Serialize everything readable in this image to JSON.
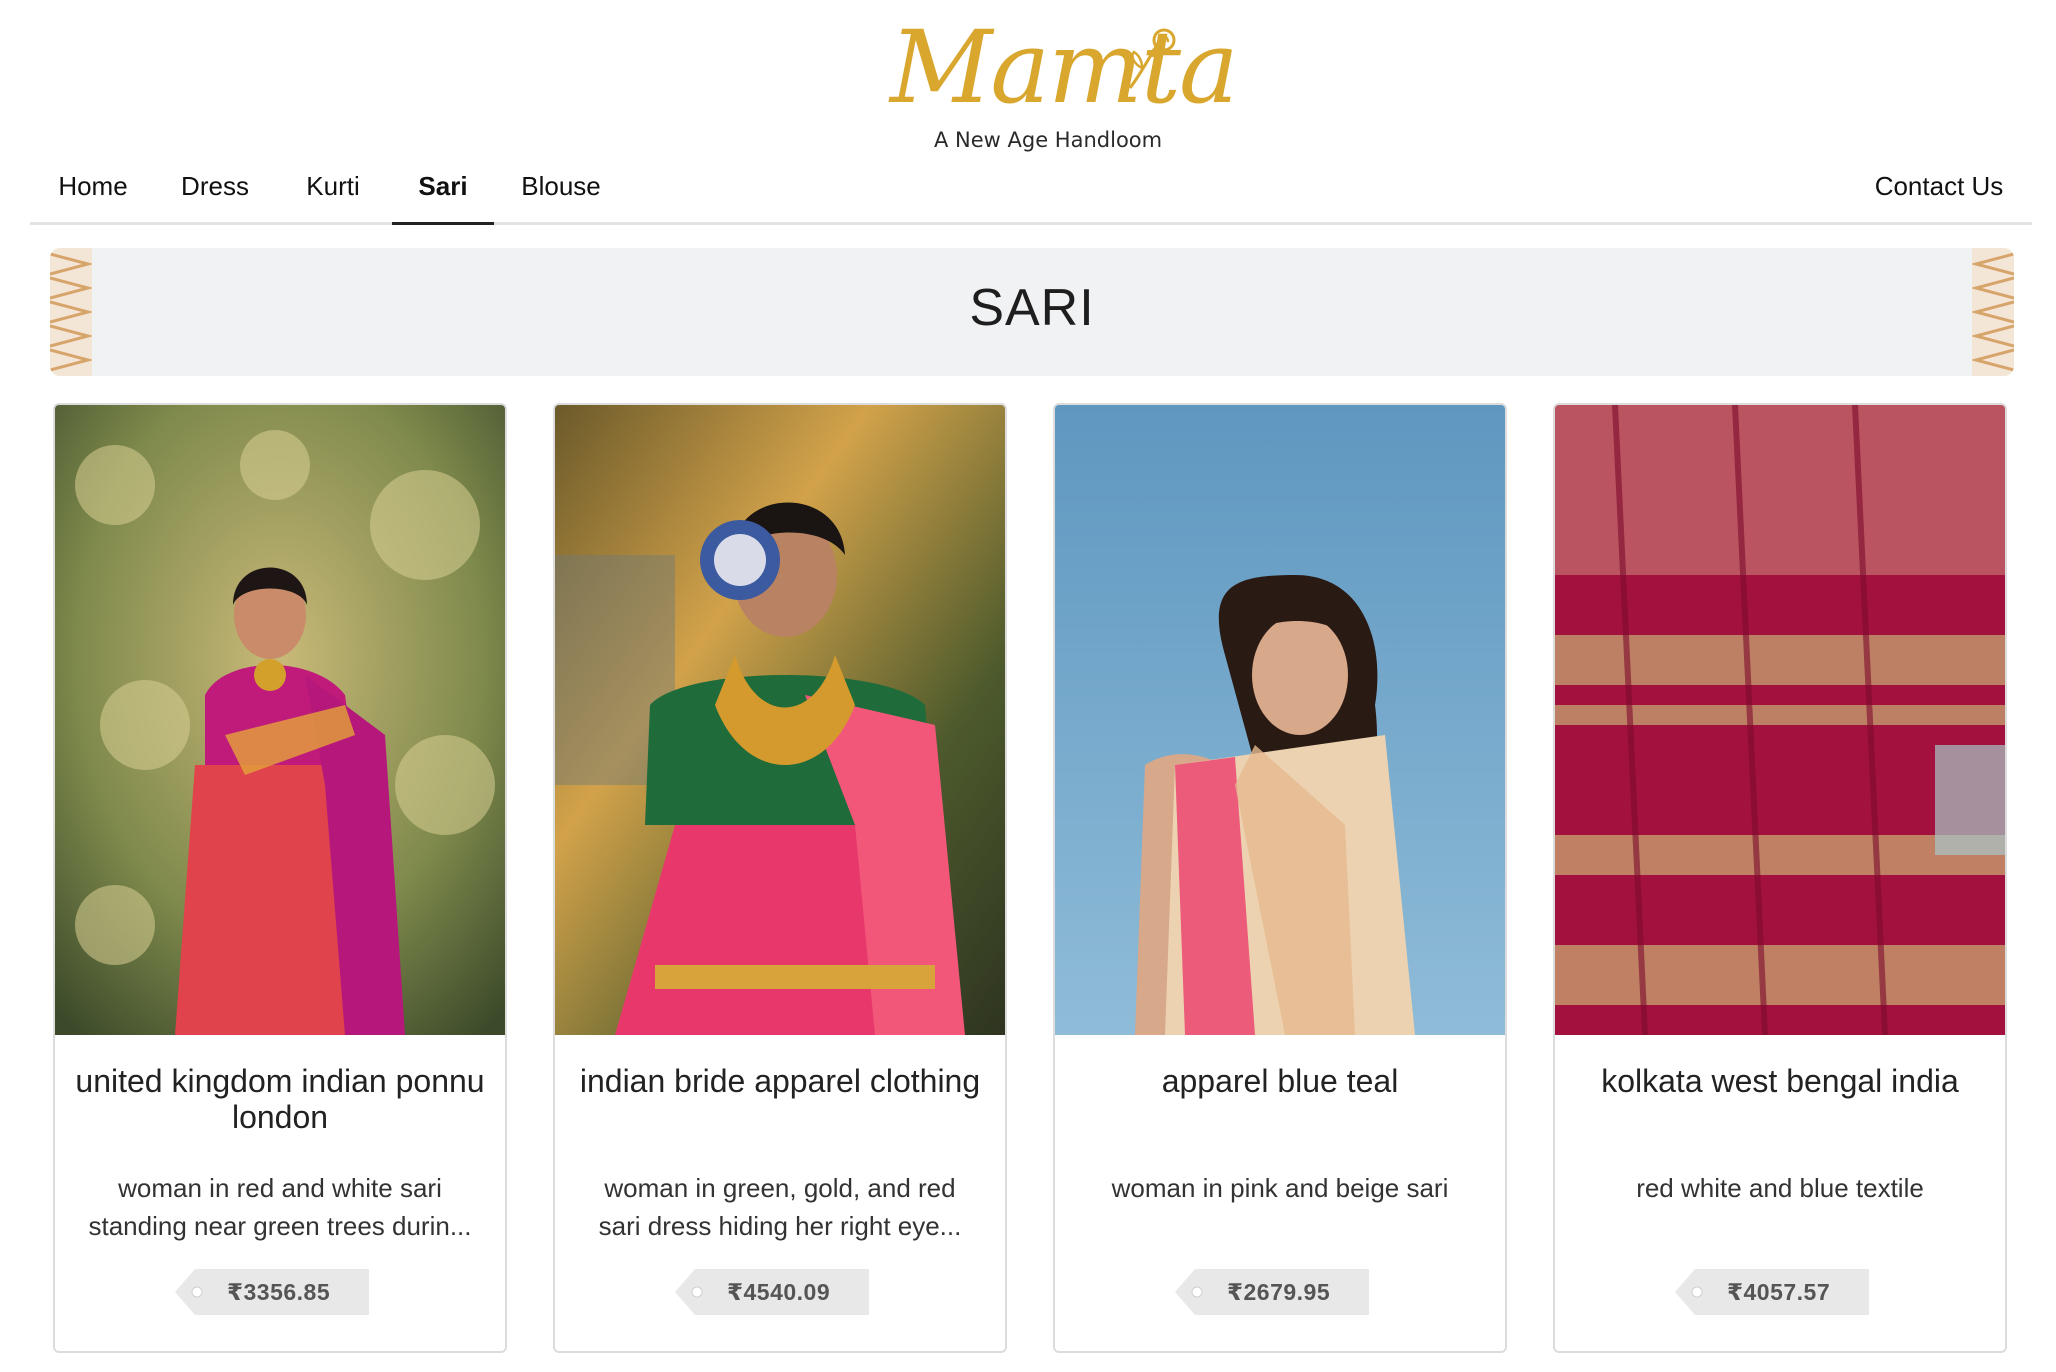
{
  "brand": {
    "name": "Mamta",
    "tagline": "A New Age Handloom"
  },
  "nav": {
    "items": [
      {
        "label": "Home"
      },
      {
        "label": "Dress"
      },
      {
        "label": "Kurti"
      },
      {
        "label": "Sari",
        "active": true
      },
      {
        "label": "Blouse"
      }
    ],
    "contact": "Contact Us"
  },
  "banner": {
    "title": "SARI"
  },
  "products": [
    {
      "title": "united kingdom indian ponnu london",
      "description": "woman in red and white sari standing near green trees durin...",
      "price": "₹3356.85",
      "image": "woman in red sari near trees"
    },
    {
      "title": "indian bride apparel clothing",
      "description": "woman in green, gold, and red sari dress hiding her right eye...",
      "price": "₹4540.09",
      "image": "bride holding ornament over eye"
    },
    {
      "title": "apparel blue teal",
      "description": "woman in pink and beige sari",
      "price": "₹2679.95",
      "image": "woman in beige sari against blue sky"
    },
    {
      "title": "kolkata west bengal india",
      "description": "red white and blue textile",
      "price": "₹4057.57",
      "image": "red and gold sari textile"
    }
  ],
  "colors": {
    "brand_gold": "#d9a62e",
    "banner_bg": "#f1f2f4",
    "tag_bg": "#e8e8e8"
  }
}
